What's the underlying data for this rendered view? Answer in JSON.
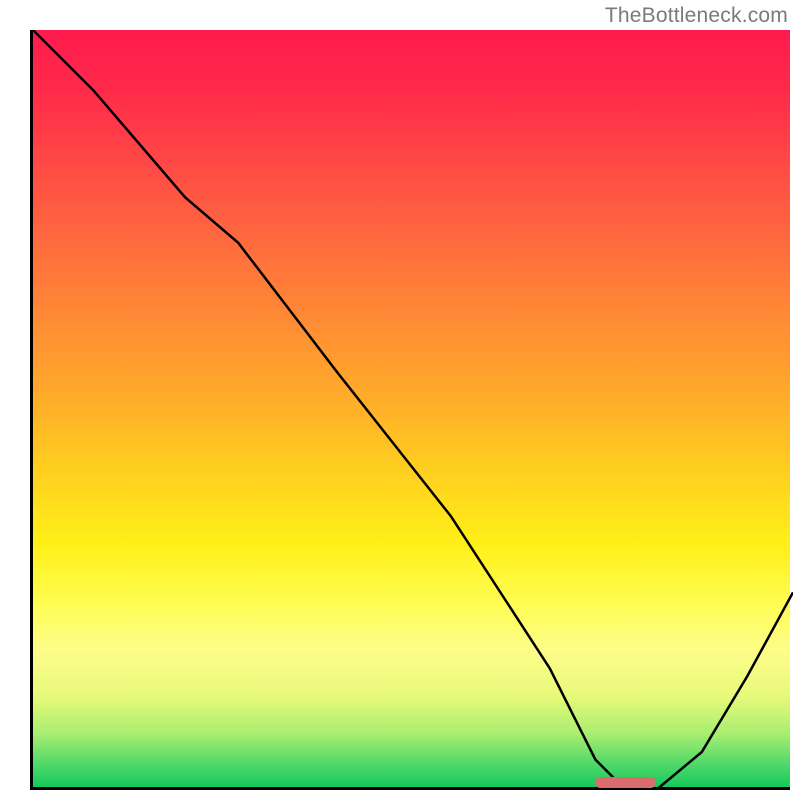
{
  "watermark": "TheBottleneck.com",
  "chart_data": {
    "type": "line",
    "title": "",
    "xlabel": "",
    "ylabel": "",
    "xlim": [
      0,
      100
    ],
    "ylim": [
      0,
      100
    ],
    "x": [
      0,
      8,
      20,
      27,
      40,
      55,
      68,
      74,
      78,
      82,
      88,
      94,
      100
    ],
    "values": [
      100,
      92,
      78,
      72,
      55,
      36,
      16,
      4,
      0,
      0,
      5,
      15,
      26
    ],
    "marker": {
      "x_start": 74,
      "x_end": 82,
      "y": 0
    },
    "colors": {
      "gradient_top": "#ff1a4d",
      "gradient_bottom": "#16c95c",
      "curve": "#000000",
      "marker": "#d96d6d"
    }
  }
}
